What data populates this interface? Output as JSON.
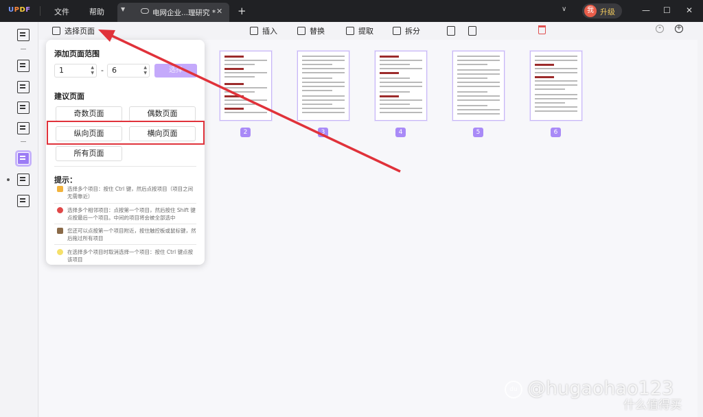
{
  "app": {
    "logo": "UPDF",
    "menus": [
      "文件",
      "帮助"
    ],
    "tab_title": "电网企业...理研究 *",
    "upgrade_label": "升级",
    "avatar_char": "我"
  },
  "toolbar": {
    "select_pages": "选择页面",
    "insert": "插入",
    "replace": "替换",
    "extract": "提取",
    "split": "拆分"
  },
  "panel": {
    "range_heading": "添加页面范围",
    "range_from": "1",
    "range_to": "6",
    "range_sep": "-",
    "confirm_label": "选择",
    "suggest_heading": "建议页面",
    "options": [
      "奇数页面",
      "偶数页面",
      "纵向页面",
      "横向页面",
      "所有页面"
    ],
    "tips_heading": "提示：",
    "tips": [
      "选择多个项目：按住 Ctrl 键，然后点按项目（项目之间无需靠近）",
      "选择多个相邻项目：点按第一个项目，然后按住 Shift 键点按最后一个项目。中间的项目将会被全部选中",
      "您还可以点按第一个项目附近，按住触控板或鼠标键，然后拖过所有项目",
      "在选择多个项目时取消选择一个项目：按住 Ctrl 键点按该项目"
    ]
  },
  "pages": [
    {
      "number": "2"
    },
    {
      "number": "3"
    },
    {
      "number": "4"
    },
    {
      "number": "5"
    },
    {
      "number": "6"
    }
  ],
  "watermark": {
    "handle": "@hugaohao123",
    "site": "什么值得买",
    "logo_text": "du"
  },
  "colors": {
    "accent": "#a98af7",
    "highlight_box": "#e0323a",
    "arrow": "#e0323a",
    "titlebar": "#202124"
  }
}
